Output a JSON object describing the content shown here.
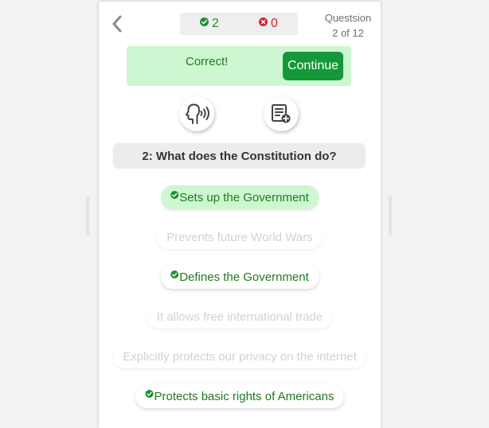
{
  "header": {
    "back_icon": "chevron-left-icon",
    "score": {
      "correct": "2",
      "wrong": "0"
    },
    "question_label": "Questsion",
    "question_progress": "2 of 12"
  },
  "feedback": {
    "message": "Correct!",
    "continue_label": "Continue"
  },
  "tools": [
    {
      "icon": "speak-icon"
    },
    {
      "icon": "add-note-icon"
    }
  ],
  "question": {
    "text": "2: What does the Constitution do?"
  },
  "answers": [
    {
      "text": "Sets up the Government",
      "state": "selected-correct"
    },
    {
      "text": "Prevents future World Wars",
      "state": "faded"
    },
    {
      "text": "Defines the Government",
      "state": "correct"
    },
    {
      "text": "It allows free international trade",
      "state": "faded"
    },
    {
      "text": "Explicitly protects our privacy on the internet",
      "state": "faded"
    },
    {
      "text": "Protects basic rights of Americans",
      "state": "correct"
    }
  ],
  "colors": {
    "correct_green": "#1f8f2e",
    "wrong_red": "#d9252a",
    "banner_bg": "#cdf7d0",
    "button_green": "#14983a"
  }
}
